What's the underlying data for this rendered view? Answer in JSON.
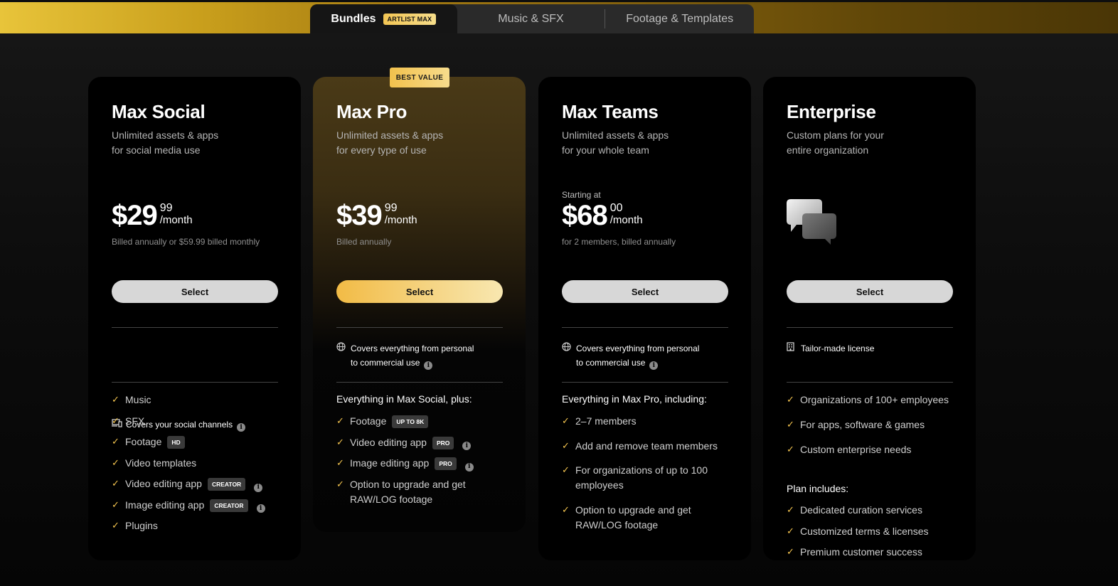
{
  "tabs": {
    "bundles": "Bundles",
    "bundles_badge": "ARTLIST MAX",
    "music": "Music & SFX",
    "footage": "Footage & Templates"
  },
  "colors": {
    "accent_gold": "#f3c44f",
    "background": "#0e0e0e",
    "card": "#000000",
    "button": "#d7d7d7"
  },
  "plans": [
    {
      "name": "Max Social",
      "desc1": "Unlimited assets & apps",
      "desc2": "for social media use",
      "price_main": "$29",
      "price_cents": "99",
      "price_per": "/month",
      "billed": "Billed annually or $59.99 billed monthly",
      "select": "Select",
      "usage": "Covers your social channels",
      "usage_icon": "devices-icon",
      "features": [
        {
          "label": "Music"
        },
        {
          "label": "SFX"
        },
        {
          "label": "Footage",
          "tag": "HD"
        },
        {
          "label": "Video templates"
        },
        {
          "label": "Video editing app",
          "tag": "CREATOR",
          "info": true
        },
        {
          "label": "Image editing app",
          "tag": "CREATOR",
          "info": true
        },
        {
          "label": "Plugins"
        }
      ]
    },
    {
      "name": "Max Pro",
      "badge": "BEST VALUE",
      "desc1": "Unlimited assets & apps",
      "desc2": "for every type of use",
      "price_main": "$39",
      "price_cents": "99",
      "price_per": "/month",
      "billed": "Billed annually",
      "select": "Select",
      "usage_line1": "Covers everything from personal",
      "usage_line2": "to commercial use",
      "usage_icon": "globe-icon",
      "list_head": "Everything in Max Social, plus:",
      "features": [
        {
          "label": "Footage",
          "tag": "UP TO 8K"
        },
        {
          "label": "Video editing app",
          "tag": "PRO",
          "info": true
        },
        {
          "label": "Image editing app",
          "tag": "PRO",
          "info": true
        },
        {
          "label": "Option to upgrade and get RAW/LOG footage"
        }
      ]
    },
    {
      "name": "Max Teams",
      "desc1": "Unlimited assets & apps",
      "desc2": "for your whole team",
      "starting": "Starting at",
      "price_main": "$68",
      "price_cents": "00",
      "price_per": "/month",
      "billed": "for 2 members, billed annually",
      "select": "Select",
      "usage_line1": "Covers everything from personal",
      "usage_line2": "to commercial use",
      "usage_icon": "globe-icon",
      "list_head": "Everything in Max Pro, including:",
      "features": [
        {
          "label": "2–7 members"
        },
        {
          "label": "Add and remove team members"
        },
        {
          "label": "For organizations of up to 100 employees"
        },
        {
          "label": "Option to upgrade and get RAW/LOG footage"
        }
      ]
    },
    {
      "name": "Enterprise",
      "desc1": "Custom plans for your",
      "desc2": "entire organization",
      "select": "Select",
      "usage": "Tailor-made license",
      "usage_icon": "building-icon",
      "features": [
        {
          "label": "Organizations of 100+ employees"
        },
        {
          "label": "For apps, software & games"
        },
        {
          "label": "Custom enterprise needs"
        }
      ],
      "plan_includes": "Plan includes:",
      "includes": [
        {
          "label": "Dedicated curation services"
        },
        {
          "label": "Customized terms & licenses"
        },
        {
          "label": "Premium customer success"
        }
      ]
    }
  ]
}
